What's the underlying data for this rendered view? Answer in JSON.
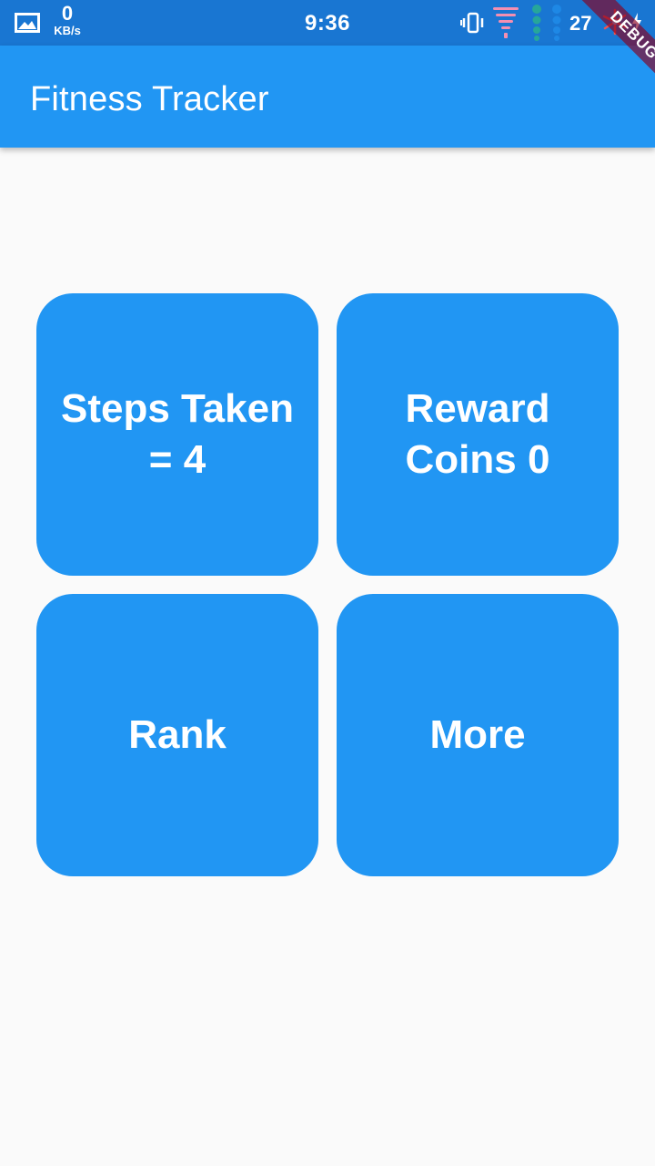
{
  "status_bar": {
    "net_speed_value": "0",
    "net_speed_unit": "KB/s",
    "time": "9:36",
    "battery": "27"
  },
  "app_bar": {
    "title": "Fitness Tracker"
  },
  "debug_banner": {
    "label": "DEBUG"
  },
  "tiles": {
    "steps": {
      "label": "Steps Taken\n= 4"
    },
    "reward": {
      "label": "Reward\nCoins 0"
    },
    "rank": {
      "label": "Rank"
    },
    "more": {
      "label": "More"
    }
  },
  "colors": {
    "status_bar": "#1976d2",
    "primary": "#2196f3",
    "background": "#fafafa",
    "debug_ribbon": "#88001e"
  },
  "icons": [
    "gallery-icon",
    "vibrate-icon",
    "signal-icon",
    "dots-icon",
    "fan-icon",
    "charging-icon"
  ]
}
